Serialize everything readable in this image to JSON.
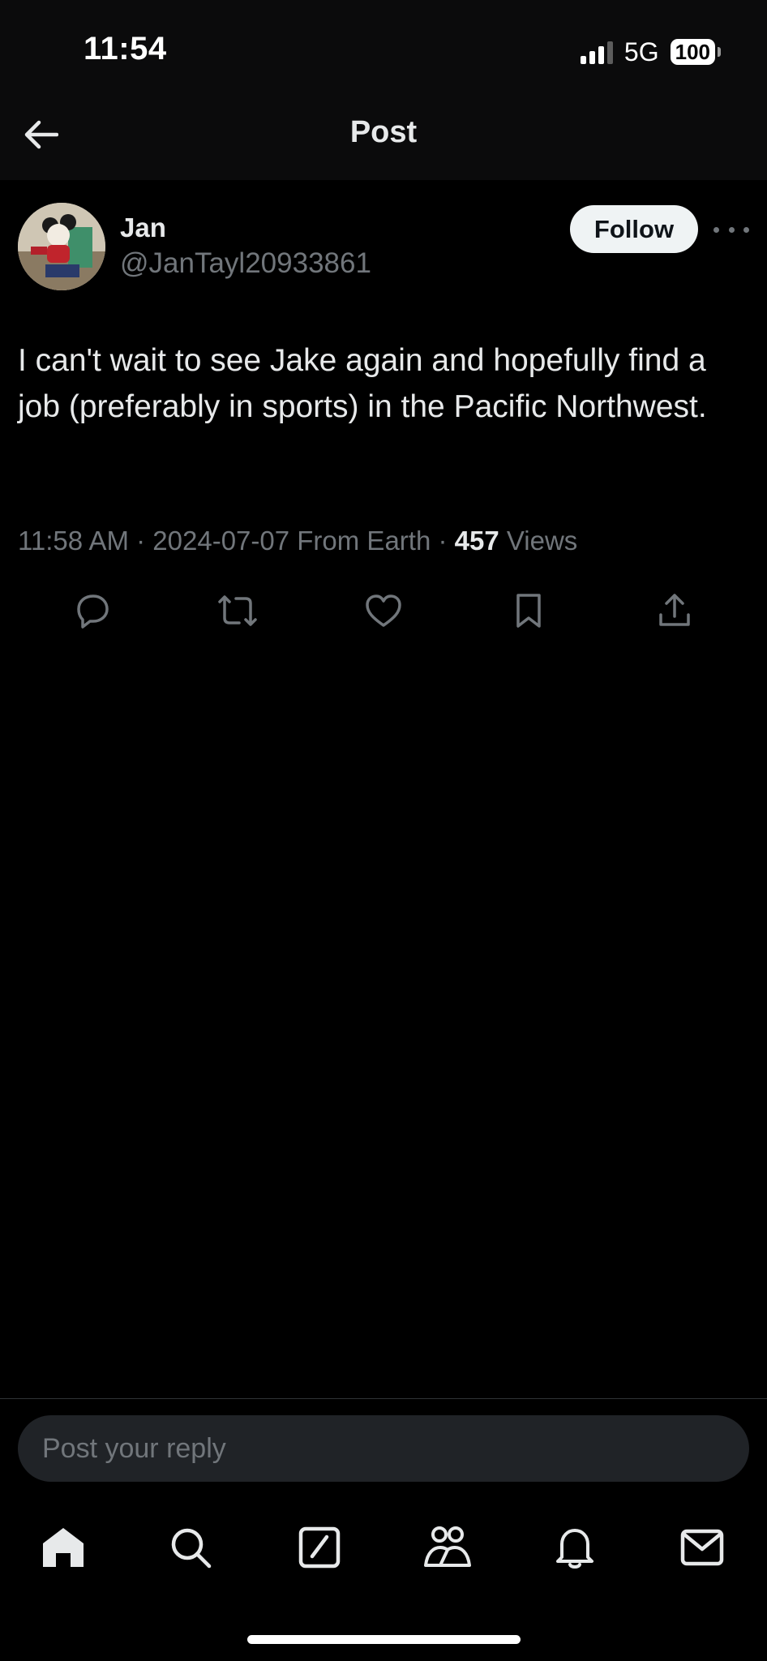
{
  "status_bar": {
    "time": "11:54",
    "network": "5G",
    "battery": "100",
    "signal_bars_active": 3,
    "signal_bars_total": 4
  },
  "header": {
    "title": "Post",
    "back_icon": "arrow-left-icon"
  },
  "post": {
    "author": {
      "display_name": "Jan",
      "handle": "@JanTayl20933861"
    },
    "follow_label": "Follow",
    "text": "I can't wait to see Jake again and hopefully find a job (preferably in sports) in the Pacific Northwest.",
    "timestamp": "11:58 AM · 2024-07-07 From Earth · ",
    "views_count": "457",
    "views_label": " Views"
  },
  "actions": [
    "reply-icon",
    "repost-icon",
    "like-icon",
    "bookmark-icon",
    "share-icon"
  ],
  "reply": {
    "placeholder": "Post your reply"
  },
  "tabbar": [
    "home-icon",
    "search-icon",
    "grok-icon",
    "communities-icon",
    "notifications-icon",
    "messages-icon"
  ],
  "colors": {
    "background": "#000000",
    "topbar": "#0b0b0c",
    "text_primary": "#e7e9ea",
    "text_secondary": "#71767b",
    "follow_bg": "#eff3f4",
    "reply_bg": "#202327"
  }
}
